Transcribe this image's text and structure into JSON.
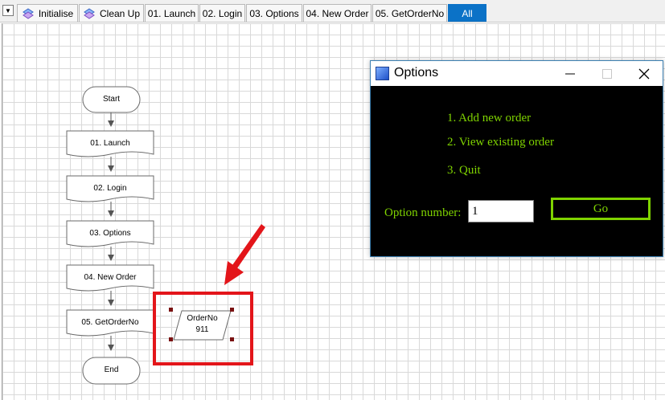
{
  "tabs": [
    {
      "label": "Initialise",
      "icon": "process-icon"
    },
    {
      "label": "Clean Up",
      "icon": "process-icon"
    },
    {
      "label": "01. Launch"
    },
    {
      "label": "02. Login"
    },
    {
      "label": "03. Options"
    },
    {
      "label": "04. New Order"
    },
    {
      "label": "05. GetOrderNo"
    },
    {
      "label": "All",
      "active": true
    }
  ],
  "flow": {
    "start": "Start",
    "stages": [
      "01. Launch",
      "02. Login",
      "03. Options",
      "04. New Order",
      "05. GetOrderNo"
    ],
    "end": "End",
    "data_item": {
      "name": "OrderNo",
      "value": "911"
    }
  },
  "window": {
    "title": "Options",
    "menu": [
      "1. Add new order",
      "2. View existing order",
      "3. Quit"
    ],
    "option_label": "Option number:",
    "option_value": "1",
    "go_label": "Go"
  },
  "colors": {
    "accent_tab": "#0b72c7",
    "console_text": "#7fd300",
    "highlight": "#e3151a"
  }
}
